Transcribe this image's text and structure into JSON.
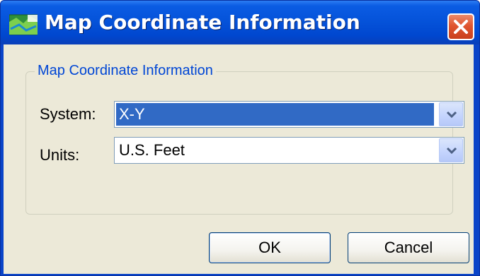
{
  "window": {
    "title": "Map Coordinate Information",
    "app_icon": "map-app-icon",
    "close_icon": "close-x-icon"
  },
  "group": {
    "title": "Map Coordinate Information"
  },
  "system": {
    "label": "System:",
    "value": "X-Y",
    "dropdown_icon": "chevron-down-icon"
  },
  "units": {
    "label": "Units:",
    "value": "U.S. Feet",
    "dropdown_icon": "chevron-down-icon"
  },
  "buttons": {
    "ok": "OK",
    "cancel": "Cancel"
  },
  "colors": {
    "titlebar": "#0553da",
    "dialog_bg": "#ece9d8",
    "group_title": "#0046d5",
    "selection": "#316ac5",
    "close_button": "#e05530"
  }
}
